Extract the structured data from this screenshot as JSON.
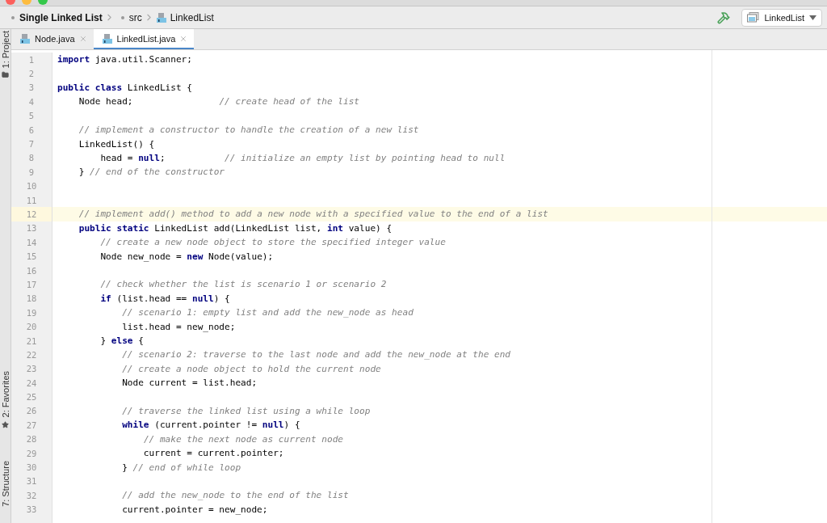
{
  "breadcrumb": [
    {
      "label": "Single Linked List",
      "kind": "project"
    },
    {
      "label": "src",
      "kind": "folder"
    },
    {
      "label": "LinkedList",
      "kind": "class"
    }
  ],
  "run_config": {
    "label": "LinkedList"
  },
  "tool_windows": [
    {
      "label": "1: Project",
      "kind": "folder"
    },
    {
      "label": "2: Favorites",
      "kind": "star"
    },
    {
      "label": "7: Structure",
      "kind": "structure"
    }
  ],
  "tabs": [
    {
      "label": "Node.java",
      "selected": false
    },
    {
      "label": "LinkedList.java",
      "selected": true
    }
  ],
  "code": [
    {
      "number": "1",
      "text": "**import** java.util.Scanner;",
      "current": false
    },
    {
      "number": "2",
      "current": false
    },
    {
      "number": "3",
      "text": "**public class** LinkedList {",
      "current": false
    },
    {
      "number": "4",
      "text": "    Node head;                *// create head of the list*",
      "current": false
    },
    {
      "number": "5",
      "current": false
    },
    {
      "number": "6",
      "text": "    *// implement a constructor to handle the creation of a new list*",
      "current": false
    },
    {
      "number": "7",
      "text": "    LinkedList() {",
      "current": false
    },
    {
      "number": "8",
      "text": "        head = **null**;           *// initialize an empty list by pointing head to null*",
      "current": false
    },
    {
      "number": "9",
      "text": "    } *// end of the constructor*",
      "current": false
    },
    {
      "number": "10",
      "current": false
    },
    {
      "number": "11",
      "current": false
    },
    {
      "number": "12",
      "text": "    *// implement add() method to add a new node with a specified value to the end of a list*",
      "current": true
    },
    {
      "number": "13",
      "text": "    **public static** LinkedList add(LinkedList list, **int** value) {",
      "current": false
    },
    {
      "number": "14",
      "text": "        *// create a new node object to store the specified integer value*",
      "current": false
    },
    {
      "number": "15",
      "text": "        Node new_node = **new** Node(value);",
      "current": false
    },
    {
      "number": "16",
      "current": false
    },
    {
      "number": "17",
      "text": "        *// check whether the list is scenario 1 or scenario 2*",
      "current": false
    },
    {
      "number": "18",
      "text": "        **if** (list.head == **null**) {",
      "current": false
    },
    {
      "number": "19",
      "text": "            *// scenario 1: empty list and add the new_node as head*",
      "current": false
    },
    {
      "number": "20",
      "text": "            list.head = new_node;",
      "current": false
    },
    {
      "number": "21",
      "text": "        } **else** {",
      "current": false
    },
    {
      "number": "22",
      "text": "            *// scenario 2: traverse to the last node and add the new_node at the end*",
      "current": false
    },
    {
      "number": "23",
      "text": "            *// create a node object to hold the current node*",
      "current": false
    },
    {
      "number": "24",
      "text": "            Node current = list.head;",
      "current": false
    },
    {
      "number": "25",
      "current": false
    },
    {
      "number": "26",
      "text": "            *// traverse the linked list using a while loop*",
      "current": false
    },
    {
      "number": "27",
      "text": "            **while** (current.pointer != **null**) {",
      "current": false
    },
    {
      "number": "28",
      "text": "                *// make the next node as current node*",
      "current": false
    },
    {
      "number": "29",
      "text": "                current = current.pointer;",
      "current": false
    },
    {
      "number": "30",
      "text": "            } *// end of while loop*",
      "current": false
    },
    {
      "number": "31",
      "current": false
    },
    {
      "number": "32",
      "text": "            *// add the new_node to the end of the list*",
      "current": false
    },
    {
      "number": "33",
      "text": "            current.pointer = new_node;",
      "current": false
    }
  ]
}
